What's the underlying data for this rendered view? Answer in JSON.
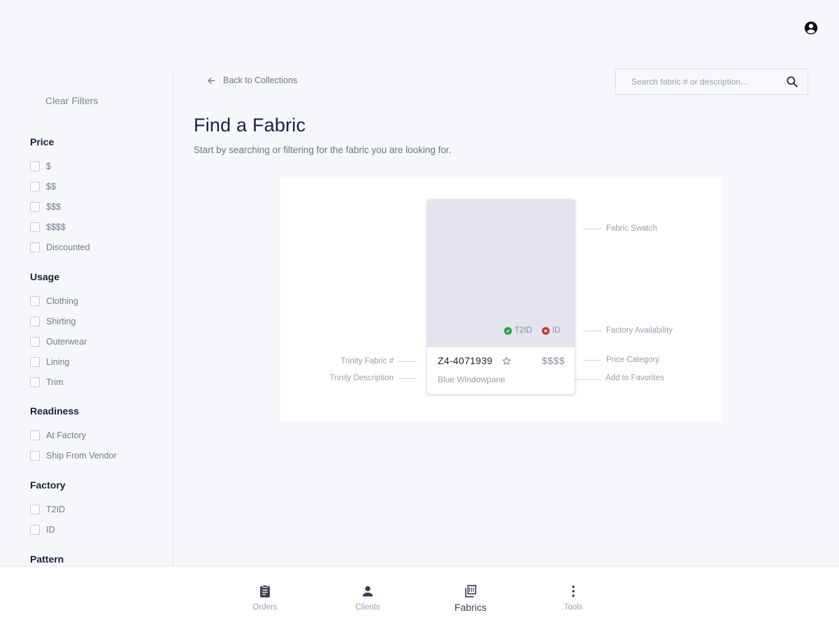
{
  "header": {
    "account_icon": "account-circle-icon"
  },
  "sidebar": {
    "clear_filters": "Clear Filters",
    "groups": [
      {
        "title": "Price",
        "options": [
          "$",
          "$$",
          "$$$",
          "$$$$",
          "Discounted"
        ]
      },
      {
        "title": "Usage",
        "options": [
          "Clothing",
          "Shirting",
          "Outerwear",
          "Lining",
          "Trim"
        ]
      },
      {
        "title": "Readiness",
        "options": [
          "At Factory",
          "Ship From Vendor"
        ]
      },
      {
        "title": "Factory",
        "options": [
          "T2ID",
          "ID"
        ]
      },
      {
        "title": "Pattern",
        "options": []
      }
    ]
  },
  "main": {
    "back_label": "Back to Collections",
    "search": {
      "placeholder": "Search fabric # or description...",
      "value": ""
    },
    "title": "Find a Fabric",
    "subtitle": "Start by searching or filtering for the fabric you are looking for."
  },
  "illustration": {
    "card": {
      "fabric_number": "Z4-4071939",
      "price": "$$$$",
      "description": "Blue Windowpane",
      "availability": [
        {
          "label": "T2ID",
          "status": "available",
          "color": "#2e9e4a"
        },
        {
          "label": "ID",
          "status": "unavailable",
          "color": "#c0392b"
        }
      ]
    },
    "callouts": {
      "fabric_swatch": "Fabric Swatch",
      "factory_availability": "Factory Availability",
      "price_category": "Price Category",
      "add_to_favorites": "Add to Favorites",
      "trinity_fabric_number": "Trinity Fabric #",
      "trinity_description": "Trinity Description"
    }
  },
  "bottom_nav": {
    "items": [
      {
        "label": "Orders",
        "icon": "clipboard-icon",
        "active": false
      },
      {
        "label": "Clients",
        "icon": "person-icon",
        "active": false
      },
      {
        "label": "Fabrics",
        "icon": "fabric-swatch-icon",
        "active": true
      },
      {
        "label": "Tools",
        "icon": "more-vertical-icon",
        "active": false
      }
    ]
  },
  "colors": {
    "background": "#f6f7fb",
    "title": "#1b1f46",
    "muted_text": "#9a9db0",
    "available": "#2e9e4a",
    "unavailable": "#c0392b"
  }
}
